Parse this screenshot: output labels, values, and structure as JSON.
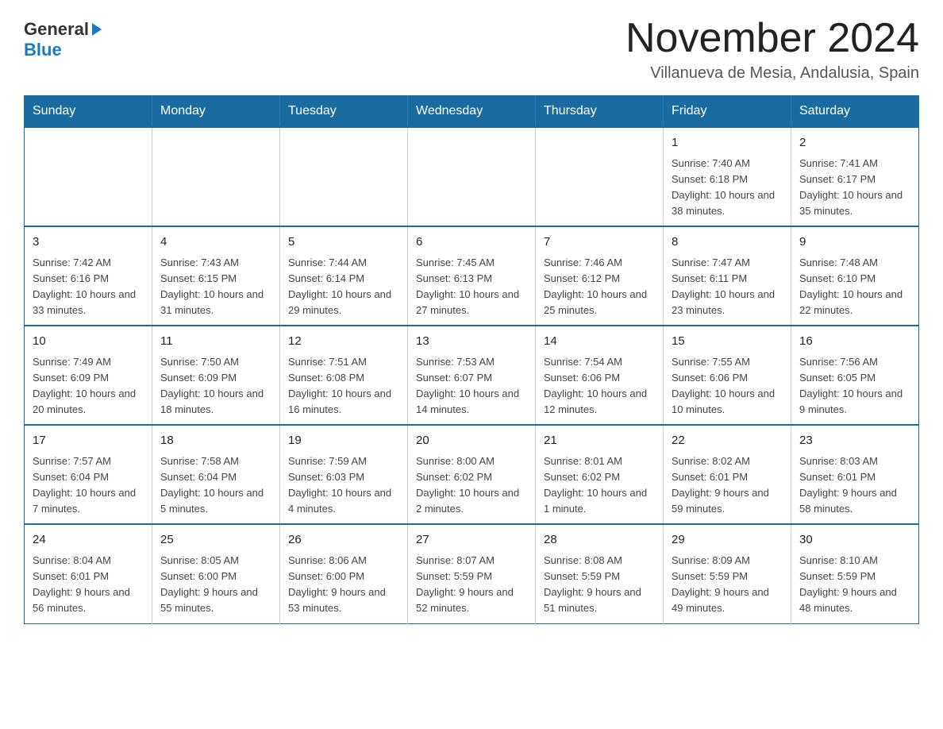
{
  "logo": {
    "general": "General",
    "blue": "Blue"
  },
  "header": {
    "month_year": "November 2024",
    "location": "Villanueva de Mesia, Andalusia, Spain"
  },
  "days_of_week": [
    "Sunday",
    "Monday",
    "Tuesday",
    "Wednesday",
    "Thursday",
    "Friday",
    "Saturday"
  ],
  "weeks": [
    [
      {
        "day": "",
        "info": ""
      },
      {
        "day": "",
        "info": ""
      },
      {
        "day": "",
        "info": ""
      },
      {
        "day": "",
        "info": ""
      },
      {
        "day": "",
        "info": ""
      },
      {
        "day": "1",
        "info": "Sunrise: 7:40 AM\nSunset: 6:18 PM\nDaylight: 10 hours and 38 minutes."
      },
      {
        "day": "2",
        "info": "Sunrise: 7:41 AM\nSunset: 6:17 PM\nDaylight: 10 hours and 35 minutes."
      }
    ],
    [
      {
        "day": "3",
        "info": "Sunrise: 7:42 AM\nSunset: 6:16 PM\nDaylight: 10 hours and 33 minutes."
      },
      {
        "day": "4",
        "info": "Sunrise: 7:43 AM\nSunset: 6:15 PM\nDaylight: 10 hours and 31 minutes."
      },
      {
        "day": "5",
        "info": "Sunrise: 7:44 AM\nSunset: 6:14 PM\nDaylight: 10 hours and 29 minutes."
      },
      {
        "day": "6",
        "info": "Sunrise: 7:45 AM\nSunset: 6:13 PM\nDaylight: 10 hours and 27 minutes."
      },
      {
        "day": "7",
        "info": "Sunrise: 7:46 AM\nSunset: 6:12 PM\nDaylight: 10 hours and 25 minutes."
      },
      {
        "day": "8",
        "info": "Sunrise: 7:47 AM\nSunset: 6:11 PM\nDaylight: 10 hours and 23 minutes."
      },
      {
        "day": "9",
        "info": "Sunrise: 7:48 AM\nSunset: 6:10 PM\nDaylight: 10 hours and 22 minutes."
      }
    ],
    [
      {
        "day": "10",
        "info": "Sunrise: 7:49 AM\nSunset: 6:09 PM\nDaylight: 10 hours and 20 minutes."
      },
      {
        "day": "11",
        "info": "Sunrise: 7:50 AM\nSunset: 6:09 PM\nDaylight: 10 hours and 18 minutes."
      },
      {
        "day": "12",
        "info": "Sunrise: 7:51 AM\nSunset: 6:08 PM\nDaylight: 10 hours and 16 minutes."
      },
      {
        "day": "13",
        "info": "Sunrise: 7:53 AM\nSunset: 6:07 PM\nDaylight: 10 hours and 14 minutes."
      },
      {
        "day": "14",
        "info": "Sunrise: 7:54 AM\nSunset: 6:06 PM\nDaylight: 10 hours and 12 minutes."
      },
      {
        "day": "15",
        "info": "Sunrise: 7:55 AM\nSunset: 6:06 PM\nDaylight: 10 hours and 10 minutes."
      },
      {
        "day": "16",
        "info": "Sunrise: 7:56 AM\nSunset: 6:05 PM\nDaylight: 10 hours and 9 minutes."
      }
    ],
    [
      {
        "day": "17",
        "info": "Sunrise: 7:57 AM\nSunset: 6:04 PM\nDaylight: 10 hours and 7 minutes."
      },
      {
        "day": "18",
        "info": "Sunrise: 7:58 AM\nSunset: 6:04 PM\nDaylight: 10 hours and 5 minutes."
      },
      {
        "day": "19",
        "info": "Sunrise: 7:59 AM\nSunset: 6:03 PM\nDaylight: 10 hours and 4 minutes."
      },
      {
        "day": "20",
        "info": "Sunrise: 8:00 AM\nSunset: 6:02 PM\nDaylight: 10 hours and 2 minutes."
      },
      {
        "day": "21",
        "info": "Sunrise: 8:01 AM\nSunset: 6:02 PM\nDaylight: 10 hours and 1 minute."
      },
      {
        "day": "22",
        "info": "Sunrise: 8:02 AM\nSunset: 6:01 PM\nDaylight: 9 hours and 59 minutes."
      },
      {
        "day": "23",
        "info": "Sunrise: 8:03 AM\nSunset: 6:01 PM\nDaylight: 9 hours and 58 minutes."
      }
    ],
    [
      {
        "day": "24",
        "info": "Sunrise: 8:04 AM\nSunset: 6:01 PM\nDaylight: 9 hours and 56 minutes."
      },
      {
        "day": "25",
        "info": "Sunrise: 8:05 AM\nSunset: 6:00 PM\nDaylight: 9 hours and 55 minutes."
      },
      {
        "day": "26",
        "info": "Sunrise: 8:06 AM\nSunset: 6:00 PM\nDaylight: 9 hours and 53 minutes."
      },
      {
        "day": "27",
        "info": "Sunrise: 8:07 AM\nSunset: 5:59 PM\nDaylight: 9 hours and 52 minutes."
      },
      {
        "day": "28",
        "info": "Sunrise: 8:08 AM\nSunset: 5:59 PM\nDaylight: 9 hours and 51 minutes."
      },
      {
        "day": "29",
        "info": "Sunrise: 8:09 AM\nSunset: 5:59 PM\nDaylight: 9 hours and 49 minutes."
      },
      {
        "day": "30",
        "info": "Sunrise: 8:10 AM\nSunset: 5:59 PM\nDaylight: 9 hours and 48 minutes."
      }
    ]
  ]
}
